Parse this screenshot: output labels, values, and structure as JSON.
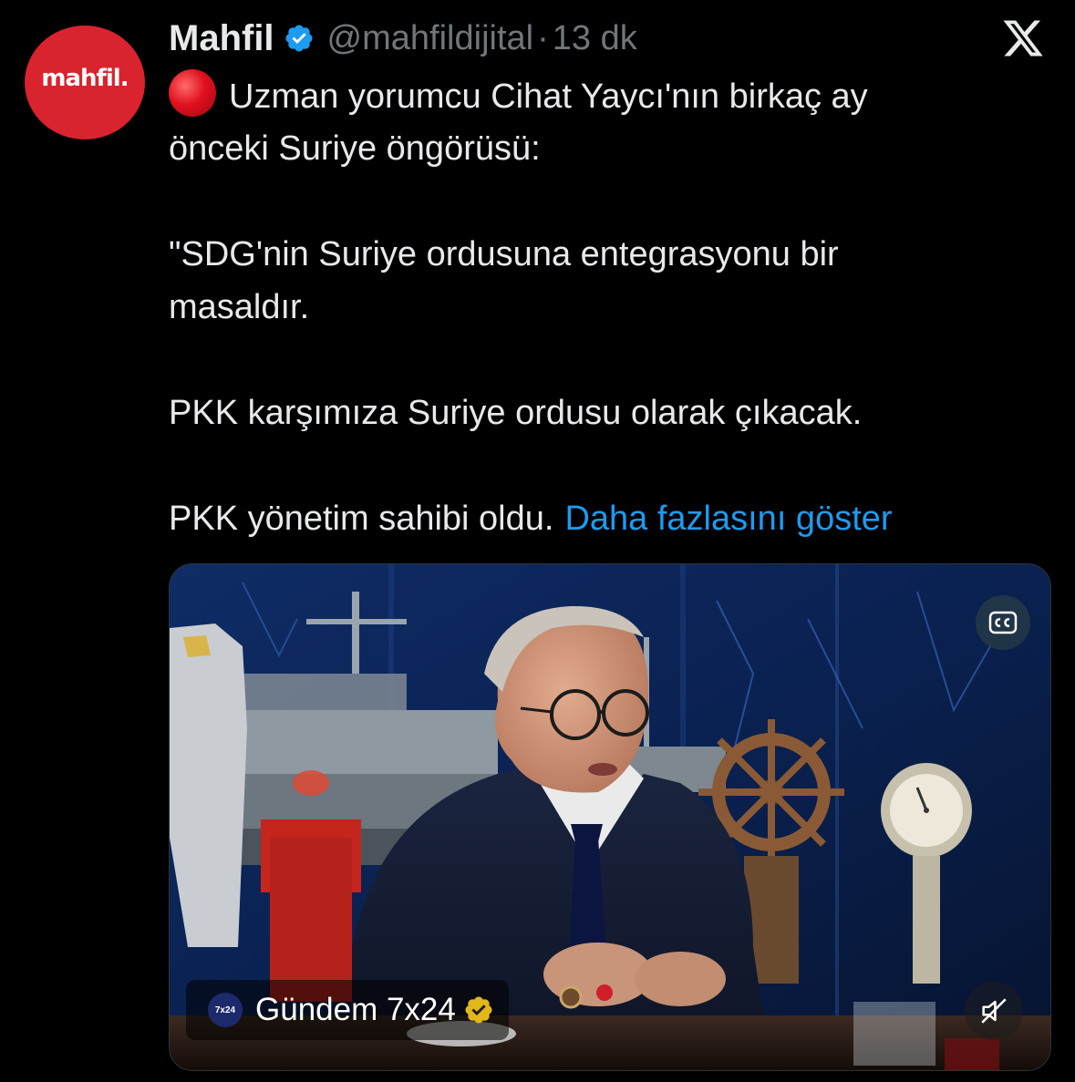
{
  "author": {
    "avatar_text": "mahfil.",
    "display_name": "Mahfil",
    "handle": "@mahfildijital",
    "separator": "·",
    "time": "13 dk",
    "verified_icon": "verified-badge-icon"
  },
  "platform": {
    "logo_icon": "x-logo-icon"
  },
  "tweet": {
    "emoji_icon": "red-circle-icon",
    "line1": "Uzman yorumcu Cihat Yaycı'nın birkaç ay",
    "line2": "önceki Suriye öngörüsü:",
    "line3": "\"SDG'nin Suriye ordusuna entegrasyonu bir",
    "line4": "masaldır.",
    "line5": "PKK karşımıza Suriye ordusu olarak çıkacak.",
    "line6": "PKK yönetim sahibi oldu.",
    "show_more": "Daha fazlasını göster"
  },
  "media": {
    "type": "video",
    "cc_icon": "closed-captions-icon",
    "mute_icon": "muted-speaker-icon",
    "channel_logo_text": "7x24",
    "channel_name": "Gündem 7x24",
    "channel_verified_icon": "gold-verified-badge-icon"
  },
  "colors": {
    "background": "#000000",
    "text": "#e7e9ea",
    "secondary_text": "#71767b",
    "link": "#1d9bf0",
    "brand_red": "#d9232e",
    "verified_blue": "#1d9bf0",
    "gold_badge": "#e2b719"
  }
}
